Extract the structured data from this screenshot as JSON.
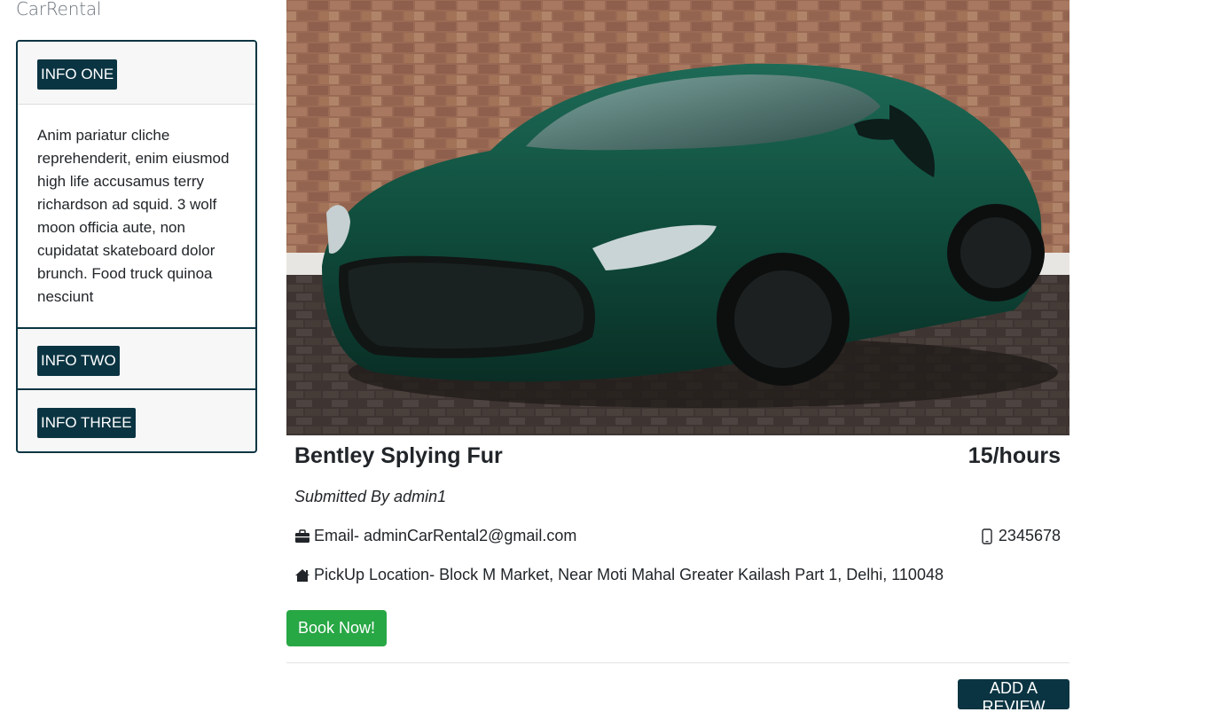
{
  "brand": "CarRental",
  "accordion": {
    "items": [
      {
        "label": "INFO ONE",
        "body": "Anim pariatur cliche reprehenderit, enim eiusmod high life accusamus terry richardson ad squid. 3 wolf moon officia aute, non cupidatat skateboard dolor brunch. Food truck quinoa nesciunt"
      },
      {
        "label": "INFO TWO"
      },
      {
        "label": "INFO THREE"
      }
    ]
  },
  "car": {
    "title": "Bentley Splying Fur",
    "price": "15/hours",
    "submitted_by": "Submitted By admin1",
    "email": "Email- adminCarRental2@gmail.com",
    "phone": "2345678",
    "pickup": "PickUp Location- Block M Market, Near Moti Mahal Greater Kailash Part 1, Delhi, 110048",
    "book_label": "Book Now!",
    "review_label": "ADD A REVIEW"
  },
  "colors": {
    "accent": "#0b3442",
    "book": "#28a745",
    "car_body": "#0f4a3a"
  },
  "icons": {
    "email": "briefcase-icon",
    "phone": "mobile-phone-icon",
    "pickup": "house-icon"
  }
}
